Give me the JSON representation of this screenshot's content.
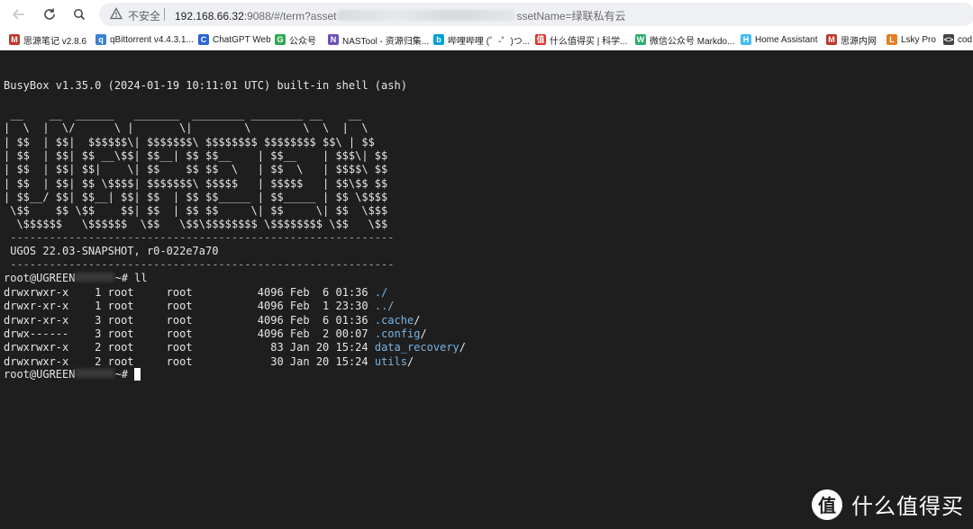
{
  "browser": {
    "insecure_label": "不安全",
    "url_host": "192.168.66.32",
    "url_path_start": ":9088/#/term?asset",
    "url_path_end": "ssetName=绿联私有云"
  },
  "bookmarks": [
    {
      "label": "思源笔记 v2.8.6",
      "icon": "siyuan-icon",
      "color": "#c0392b",
      "glyph": "M"
    },
    {
      "label": "qBittorrent v4.4.3.1...",
      "icon": "qbittorrent-icon",
      "color": "#3b7fd6",
      "glyph": "q"
    },
    {
      "label": "ChatGPT Web",
      "icon": "chatgpt-icon",
      "color": "#2b64d6",
      "glyph": "C"
    },
    {
      "label": "公众号",
      "icon": "wechat-mp-icon",
      "color": "#34a853",
      "glyph": "G"
    },
    {
      "label": "NASTool - 资源归集...",
      "icon": "nastool-icon",
      "color": "#6b4fbb",
      "glyph": "N"
    },
    {
      "label": "哔哩哔哩 (゜-゜)つ...",
      "icon": "bilibili-icon",
      "color": "#00a1d6",
      "glyph": "b"
    },
    {
      "label": "什么值得买 | 科学...",
      "icon": "smzdm-icon",
      "color": "#e0312a",
      "glyph": "值"
    },
    {
      "label": "微信公众号 Markdo...",
      "icon": "wechat-icon",
      "color": "#2aae67",
      "glyph": "W"
    },
    {
      "label": "Home Assistant",
      "icon": "home-assistant-icon",
      "color": "#41bdf5",
      "glyph": "H"
    },
    {
      "label": "思源内网",
      "icon": "siyuan-icon",
      "color": "#c0392b",
      "glyph": "M"
    },
    {
      "label": "Lsky Pro",
      "icon": "lsky-icon",
      "color": "#e67e22",
      "glyph": "L"
    },
    {
      "label": "cod",
      "icon": "code-icon",
      "color": "#444444",
      "glyph": "<>"
    }
  ],
  "terminal": {
    "banner": "BusyBox v1.35.0 (2024-01-19 10:11:01 UTC) built-in shell (ash)",
    "ascii_art": [
      " __    __  ______   _______  ________ ________ __    __ ",
      "|  \\  |  \\/      \\ |       \\|        \\        \\  \\  |  \\",
      "| $$  | $$|  $$$$$$\\| $$$$$$$\\ $$$$$$$$ $$$$$$$$ $$\\ | $$",
      "| $$  | $$| $$ __\\$$| $$__| $$ $$__    | $$__    | $$$\\| $$",
      "| $$  | $$| $$|    \\| $$    $$ $$  \\   | $$  \\   | $$$$\\ $$",
      "| $$  | $$| $$ \\$$$$| $$$$$$$\\ $$$$$   | $$$$$   | $$\\$$ $$",
      "| $$__/ $$| $$__| $$| $$  | $$ $$_____ | $$_____ | $$ \\$$$$",
      " \\$$    $$ \\$$    $$| $$  | $$ $$     \\| $$     \\| $$  \\$$$",
      "  \\$$$$$$   \\$$$$$$  \\$$   \\$$\\$$$$$$$$ \\$$$$$$$$ \\$$   \\$$"
    ],
    "divider": " -----------------------------------------------------------",
    "version": " UGOS 22.03-SNAPSHOT, r0-022e7a70",
    "prompt_user": "root@UGREEN",
    "prompt_suffix": "~# ll",
    "prompt_suffix_final": "~# ",
    "listing": [
      {
        "perm": "drwxrwxr-x",
        "links": "1",
        "owner": "root",
        "group": "root",
        "size": "4096",
        "date": "Feb  6 01:36",
        "name": "./",
        "dir": false
      },
      {
        "perm": "drwxr-xr-x",
        "links": "1",
        "owner": "root",
        "group": "root",
        "size": "4096",
        "date": "Feb  1 23:30",
        "name": "../",
        "dir": false
      },
      {
        "perm": "drwxr-xr-x",
        "links": "3",
        "owner": "root",
        "group": "root",
        "size": "4096",
        "date": "Feb  6 01:36",
        "name": ".cache",
        "dir": true
      },
      {
        "perm": "drwx------",
        "links": "3",
        "owner": "root",
        "group": "root",
        "size": "4096",
        "date": "Feb  2 00:07",
        "name": ".config",
        "dir": true
      },
      {
        "perm": "drwxrwxr-x",
        "links": "2",
        "owner": "root",
        "group": "root",
        "size": "83",
        "date": "Jan 20 15:24",
        "name": "data_recovery",
        "dir": true
      },
      {
        "perm": "drwxrwxr-x",
        "links": "2",
        "owner": "root",
        "group": "root",
        "size": "30",
        "date": "Jan 20 15:24",
        "name": "utils",
        "dir": true
      }
    ]
  },
  "watermark": {
    "logo": "值",
    "text": "什么值得买"
  }
}
